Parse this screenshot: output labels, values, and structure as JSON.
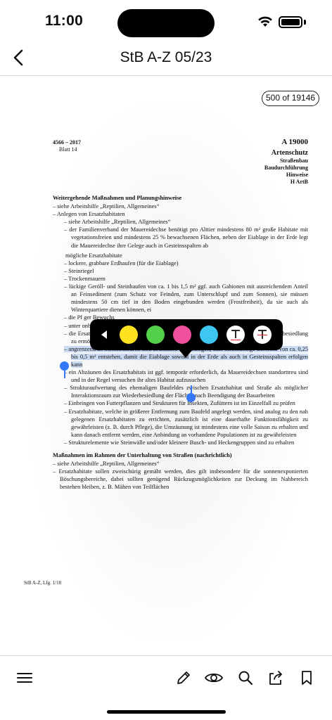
{
  "status": {
    "time": "11:00"
  },
  "nav": {
    "title": "StB A-Z 05/23"
  },
  "page_counter": "500 of 19146",
  "document": {
    "left_number": "4566 – 2017",
    "blatt": "Blatt 14",
    "right_number": "A 19000",
    "heading": "Artenschutz",
    "sub": [
      "Straßenbau",
      "Baudurchführung",
      "Hinweise",
      "H ArtB"
    ],
    "sections": [
      {
        "type": "h",
        "text": "Weitergehende Maßnahmen und Planungshinweise"
      },
      {
        "type": "l1",
        "text": "– siehe Arbeitshilfe „Reptilien, Allgemeines“"
      },
      {
        "type": "l1",
        "text": "– Anlegen von Ersatzhabitaten"
      },
      {
        "type": "l2",
        "text": "– siehe Arbeitshilfe „Reptilien, Allgemeines“"
      },
      {
        "type": "l2",
        "text": "– der Familienverband der Mauereidechse benötigt pro Alttier mindestens 80 m² große Habitate mit vegetationsfreien und mindestens 25 % bewachsenen Flächen, neben der Eiablage in der Erde legt die Mauereidechse ihre Gelege auch in Gesteinsspalten ab"
      },
      {
        "type": "sp",
        "text": ""
      },
      {
        "type": "l2p",
        "text": "mögliche Ersatzhabitate"
      },
      {
        "type": "l2",
        "text": "– lockere, grabbare Erdhaufen (für die Eiablage)"
      },
      {
        "type": "l2",
        "text": "– Steinriegel"
      },
      {
        "type": "l2",
        "text": "– Trockenmauern"
      },
      {
        "type": "l2",
        "text": "– lückige Geröll- und Steinhaufen von ca. 1 bis 1,5 m² ggf. auch Gabionen mit ausreichendem Anteil an Feinsediment (zum Schutz vor Feinden, zum Unterschlupf und zum Sonnen), sie müssen mindestens 50 cm tief in den Boden eingebunden werden (Frostfreiheit), da sie auch als Winterquartiere dienen können, ei"
      },
      {
        "type": "l2",
        "text": "– die Pf                                                                                                   ger Bewuchs"
      },
      {
        "type": "l2",
        "text": "– unter                                                                                                      onbruch als Strukturelemente verwendet werden"
      },
      {
        "type": "l2",
        "text": "– die Ersatzhabitate sind prioritär nahe des Baufeldes zu errichten, um eine spätere Wiederbesiedlung zu ermöglichen"
      },
      {
        "type": "l2sel",
        "text": "– angrenzend an Steinstrukturen sind Erdhaufen so anzulegen, dass kleinflächige Bereiche von ca. 0,25 bis 0,5 m² entstehen, damit die Eiablage sowohl in der Erde als auch in Gesteinsspalten erfolgen kann"
      },
      {
        "type": "l2",
        "text": "– ein Abzäunen des Ersatzhabitats ist ggf. temporär erforderlich, da Mauereidechsen standorttreu sind und in der Regel versuchen ihr altes Habitat aufzusuchen"
      },
      {
        "type": "l2",
        "text": "– Strukturaufwertung des ehemaligen Baufeldes zwischen Ersatzhabitat und Straße als möglicher Interaktionsraum zur Wiederbesiedlung der Flächen nach Beendigung der Bauarbeiten"
      },
      {
        "type": "l2",
        "text": "– Einbringen von Futterpflanzen und Strukturen für Insekten, Zufüttern ist im Einzelfall zu prüfen"
      },
      {
        "type": "l2",
        "text": "– Ersatzhabitate, welche in größerer Entfernung zum Baufeld angelegt werden, sind analog zu den nah gelegenen Ersatzhabitaten zu errichten, zusätzlich ist eine dauerhafte Funktionsfähigkeit zu gewährleisten (z. B. durch Pflege), die Umzäunung ist mindestens eine volle Saison zu erhalten und kann danach entfernt werden, eine Anbindung an vorhandene Populationen ist zu gewährleisten"
      },
      {
        "type": "l2",
        "text": "– Strukturelemente wie Steinwälle und/oder kleinere Busch- und Heckengruppen sind zu erhalten"
      },
      {
        "type": "gap",
        "text": ""
      },
      {
        "type": "h",
        "text": "Maßnahmen im Rahmen der Unterhaltung von Straßen (nachrichtlich)"
      },
      {
        "type": "l1",
        "text": "– siehe Arbeitshilfe „Reptilien, Allgemeines“"
      },
      {
        "type": "l1",
        "text": "– Ersatzhabitate sollen zweischürig gemäht werden, dies gilt insbesondere für die sonnenexponierten Böschungsbereiche, dabei sollten genügend Rückzugsmöglichkeiten zur Deckung im Nahbereich bestehen bleiben, z. B. Mähen von Teilflächen"
      }
    ],
    "footer": "StB A-Z, Lfg. 1/18"
  },
  "color_toolbar": {
    "colors": [
      {
        "name": "yellow-swatch",
        "color": "#ffe21f"
      },
      {
        "name": "green-swatch",
        "color": "#55d04a"
      },
      {
        "name": "pink-swatch",
        "color": "#f0509e"
      },
      {
        "name": "blue-swatch",
        "color": "#3ec7f0"
      }
    ]
  },
  "icons": {
    "back": "chevron-left-icon",
    "menu": "menu-icon",
    "pencil": "pencil-icon",
    "eye": "eye-icon",
    "search": "search-icon",
    "share": "share-icon",
    "bookmark": "bookmark-icon"
  }
}
